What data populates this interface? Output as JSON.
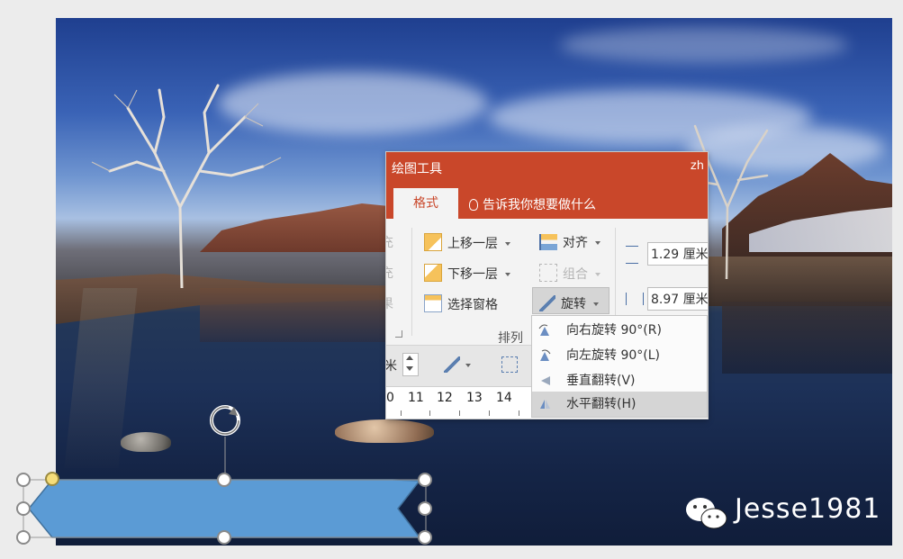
{
  "ribbon": {
    "context_title": "绘图工具",
    "user": "zh",
    "active_tab": "格式",
    "tell_me": "告诉我你想要做什么",
    "bring_forward": "上移一层",
    "send_backward": "下移一层",
    "selection_pane": "选择窗格",
    "align": "对齐",
    "group": "组合",
    "rotate": "旋转",
    "height_value": "1.29 厘米",
    "width_value": "8.97 厘米",
    "arrange_label": "排列",
    "left_partial_1": "充",
    "left_partial_2": "充",
    "left_partial_3": "果",
    "unit_partial": "米",
    "ruler_ticks": [
      "0",
      "11",
      "12",
      "13",
      "14"
    ]
  },
  "rotate_menu": {
    "items": [
      {
        "label": "向右旋转 90°(R)"
      },
      {
        "label": "向左旋转 90°(L)"
      },
      {
        "label": "垂直翻转(V)"
      },
      {
        "label": "水平翻转(H)"
      }
    ],
    "highlighted_index": 3
  },
  "slide": {
    "shape_fill": "#5b9bd5",
    "watermark": "Jesse1981"
  },
  "colors": {
    "ribbon_accent": "#c9472a"
  }
}
